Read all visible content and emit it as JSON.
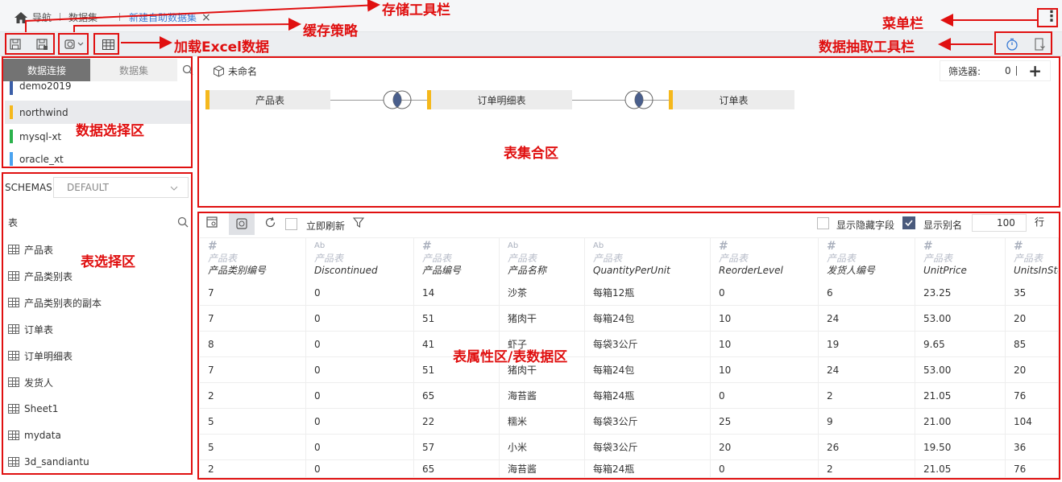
{
  "nav": {
    "home_label": "导航",
    "dataset_label": "数据集",
    "active_tab": "新建自助数据集",
    "close": "×",
    "menu_dots": "⋮"
  },
  "annotations": {
    "storage_toolbar": "存储工具栏",
    "cache_policy": "缓存策略",
    "load_excel": "加载Excel数据",
    "menu_bar": "菜单栏",
    "extract_toolbar": "数据抽取工具栏",
    "data_select_area": "数据选择区",
    "table_select_area": "表选择区",
    "table_merge_area": "表集合区",
    "table_prop_area": "表属性区/表数据区"
  },
  "left": {
    "tabs": [
      "数据连接",
      "数据集"
    ],
    "connections": [
      {
        "name": "demo2019",
        "color": "#3b5fa8"
      },
      {
        "name": "northwind",
        "color": "#f5b81c",
        "selected": true
      },
      {
        "name": "mysql-xt",
        "color": "#2bb24c"
      },
      {
        "name": "oracle_xt",
        "color": "#4aa3f0"
      }
    ],
    "schemas_label": "SCHEMAS",
    "schema_value": "DEFAULT",
    "tables_label": "表",
    "tables": [
      "产品表",
      "产品类别表",
      "产品类别表的副本",
      "订单表",
      "订单明细表",
      "发货人",
      "Sheet1",
      "mydata",
      "3d_sandiantu"
    ]
  },
  "merge": {
    "name": "未命名",
    "filter_label": "筛选器:",
    "filter_count": "0",
    "add": "+",
    "nodes": [
      "产品表",
      "订单明细表",
      "订单表"
    ]
  },
  "grid": {
    "refresh_label": "立即刷新",
    "show_hidden_label": "显示隐藏字段",
    "show_alias_label": "显示别名",
    "rows_value": "100",
    "rows_unit": "行",
    "columns": [
      {
        "type": "#",
        "table": "产品表",
        "name": "产品类别编号"
      },
      {
        "type": "Ab",
        "table": "产品表",
        "name": "Discontinued"
      },
      {
        "type": "#",
        "table": "产品表",
        "name": "产品编号"
      },
      {
        "type": "Ab",
        "table": "产品表",
        "name": "产品名称"
      },
      {
        "type": "Ab",
        "table": "产品表",
        "name": "QuantityPerUnit"
      },
      {
        "type": "#",
        "table": "产品表",
        "name": "ReorderLevel"
      },
      {
        "type": "#",
        "table": "产品表",
        "name": "发货人编号"
      },
      {
        "type": "#",
        "table": "产品表",
        "name": "UnitPrice"
      },
      {
        "type": "#",
        "table": "产品表",
        "name": "UnitsInSto"
      }
    ],
    "rows": [
      [
        "7",
        "0",
        "14",
        "沙茶",
        "每箱12瓶",
        "0",
        "6",
        "23.25",
        "35"
      ],
      [
        "7",
        "0",
        "51",
        "猪肉干",
        "每箱24包",
        "10",
        "24",
        "53.00",
        "20"
      ],
      [
        "8",
        "0",
        "41",
        "虾子",
        "每袋3公斤",
        "10",
        "19",
        "9.65",
        "85"
      ],
      [
        "7",
        "0",
        "51",
        "猪肉干",
        "每箱24包",
        "10",
        "24",
        "53.00",
        "20"
      ],
      [
        "2",
        "0",
        "65",
        "海苔酱",
        "每箱24瓶",
        "0",
        "2",
        "21.05",
        "76"
      ],
      [
        "5",
        "0",
        "22",
        "糯米",
        "每袋3公斤",
        "25",
        "9",
        "21.00",
        "104"
      ],
      [
        "5",
        "0",
        "57",
        "小米",
        "每袋3公斤",
        "20",
        "26",
        "19.50",
        "36"
      ],
      [
        "2",
        "0",
        "65",
        "海苔酱",
        "每箱24瓶",
        "0",
        "2",
        "21.05",
        "76"
      ]
    ]
  }
}
